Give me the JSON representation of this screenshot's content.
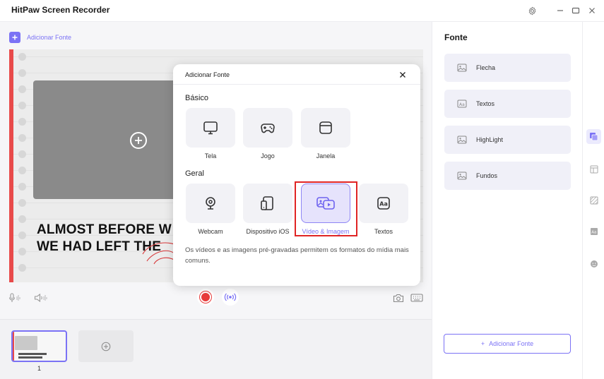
{
  "app": {
    "title": "HitPaw Screen Recorder"
  },
  "toolbar": {
    "add_source_label": "Adicionar Fonte"
  },
  "canvas": {
    "line1": "ALMOST BEFORE W",
    "line2": "WE HAD LEFT THE"
  },
  "scenes": {
    "items": [
      {
        "number": "1"
      }
    ]
  },
  "right_panel": {
    "title": "Fonte",
    "items": [
      {
        "label": "Flecha",
        "icon": "image-icon"
      },
      {
        "label": "Textos",
        "icon": "text-icon"
      },
      {
        "label": "HighLight",
        "icon": "image-icon"
      },
      {
        "label": "Fundos",
        "icon": "image-icon"
      }
    ],
    "add_button_label": "Adicionar Fonte"
  },
  "dialog": {
    "title": "Adicionar Fonte",
    "basic_section": "Básico",
    "general_section": "Geral",
    "basic_tiles": [
      {
        "label": "Tela",
        "icon": "monitor-icon"
      },
      {
        "label": "Jogo",
        "icon": "gamepad-icon"
      },
      {
        "label": "Janela",
        "icon": "window-icon"
      }
    ],
    "general_tiles": [
      {
        "label": "Webcam",
        "icon": "webcam-icon"
      },
      {
        "label": "Dispositivo iOS",
        "icon": "devices-icon"
      },
      {
        "label": "Vídeo & Imagem",
        "icon": "media-icon",
        "selected": true
      },
      {
        "label": "Textos",
        "icon": "text-icon"
      }
    ],
    "description": "Os vídeos e as imagens pré-gravadas permitem os formatos do mídia mais comuns."
  },
  "colors": {
    "accent": "#7b72f5",
    "record": "#e83b3b",
    "highlight": "#e02424"
  }
}
